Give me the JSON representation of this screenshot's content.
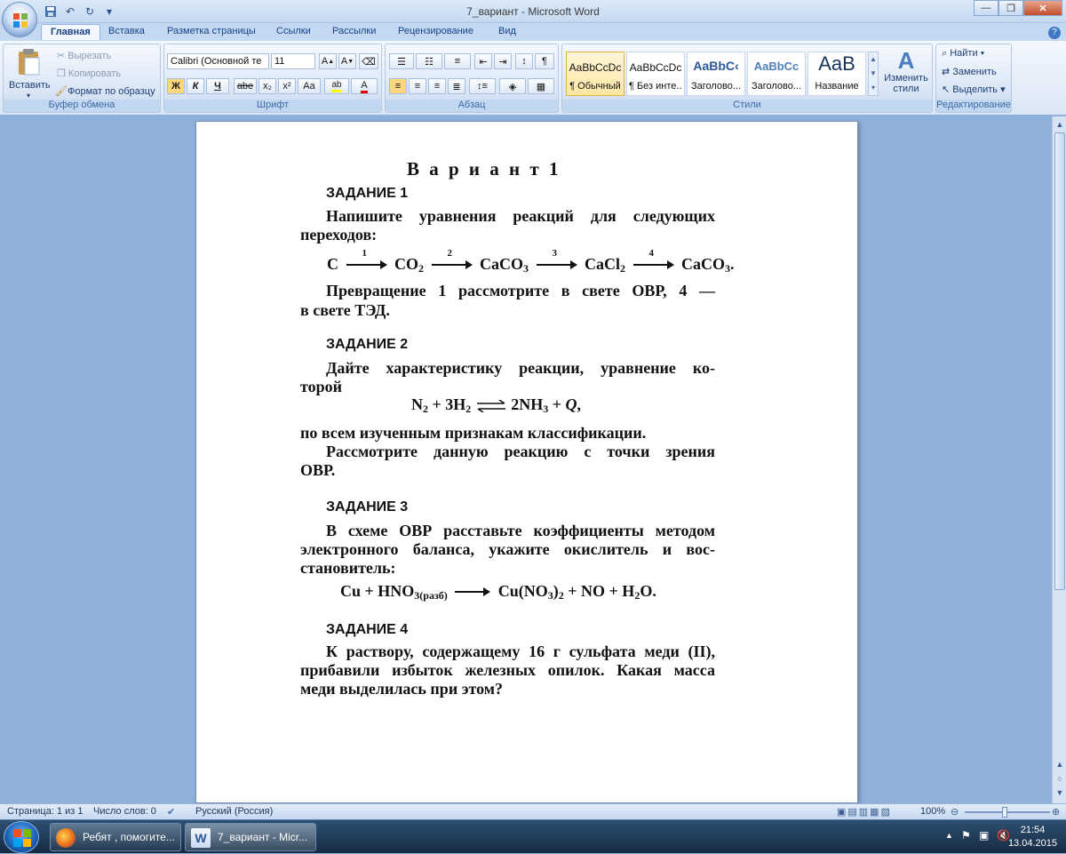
{
  "window": {
    "title": "7_вариант - Microsoft Word",
    "qat": [
      "save-icon",
      "undo-icon",
      "redo-icon",
      "customize-icon"
    ]
  },
  "tabs": [
    "Главная",
    "Вставка",
    "Разметка страницы",
    "Ссылки",
    "Рассылки",
    "Рецензирование",
    "Вид"
  ],
  "ribbon": {
    "clipboard": {
      "label": "Буфер обмена",
      "paste": "Вставить",
      "cut": "Вырезать",
      "copy": "Копировать",
      "format_painter": "Формат по образцу"
    },
    "font": {
      "label": "Шрифт",
      "font_name": "Calibri (Основной те",
      "font_size": "11",
      "bold": "Ж",
      "italic": "К",
      "underline": "Ч",
      "strike": "abe",
      "sub": "x₂",
      "sup": "x²",
      "case": "Aa"
    },
    "paragraph": {
      "label": "Абзац"
    },
    "styles": {
      "label": "Стили",
      "items": [
        {
          "sample": "AaBbCcDc",
          "name": "¶ Обычный"
        },
        {
          "sample": "AaBbCcDc",
          "name": "¶ Без инте..."
        },
        {
          "sample": "AaBbC‹",
          "name": "Заголово..."
        },
        {
          "sample": "AaBbCc",
          "name": "Заголово..."
        },
        {
          "sample": "AaB",
          "name": "Название"
        }
      ],
      "change": "Изменить стили"
    },
    "editing": {
      "label": "Редактирование",
      "find": "Найти",
      "replace": "Заменить",
      "select": "Выделить"
    }
  },
  "document": {
    "title": "В а р и а н т  1",
    "task1": {
      "heading": "ЗАДАНИЕ 1",
      "line1": "Напишите уравнения реакций для следующих",
      "line2": "переходов:",
      "note1": "Превращение 1 рассмотрите в свете ОВР, 4 —",
      "note2": "в свете ТЭД."
    },
    "task2": {
      "heading": "ЗАДАНИЕ 2",
      "line1": "Дайте характеристику реакции, уравнение ко-",
      "line2": "торой",
      "line3": "по всем изученным признакам классификации.",
      "line4": "Рассмотрите данную реакцию с точки зрения",
      "line5": "ОВР."
    },
    "task3": {
      "heading": "ЗАДАНИЕ 3",
      "line1": "В схеме ОВР расставьте коэффициенты методом",
      "line2": "электронного баланса, укажите окислитель и вос-",
      "line3": "становитель:"
    },
    "task4": {
      "heading": "ЗАДАНИЕ 4",
      "line1": "К раствору, содержащему 16 г сульфата меди (II),",
      "line2": "прибавили избыток железных опилок. Какая масса",
      "line3": "меди выделилась при этом?"
    },
    "eq1": {
      "t1": "C",
      "a1": "1",
      "t2": "CO",
      "t2s": "2",
      "a2": "2",
      "t3": "CaCO",
      "t3s": "3",
      "a3": "3",
      "t4": "CaCl",
      "t4s": "2",
      "a4": "4",
      "t5": "CaCO",
      "t5s": "3",
      "t5e": "."
    },
    "eq2": {
      "p1": "N",
      "p1s": "2",
      "p2": " + 3H",
      "p2s": "2",
      "p3": "2NH",
      "p3s": "3",
      "p4": " + ",
      "q": "Q",
      "p5": ","
    },
    "eq3": {
      "p1": "Cu + HNO",
      "p1s": "3(разб)",
      "p2": "Cu(NO",
      "p2s1": "3",
      "p2m": ")",
      "p2s2": "2",
      "p3": " + NO + H",
      "p3s": "2",
      "p4": "O."
    }
  },
  "status": {
    "page": "Страница: 1 из 1",
    "words": "Число слов: 0",
    "lang": "Русский (Россия)",
    "zoom": "100%"
  },
  "taskbar": {
    "items": [
      {
        "label": "Ребят , помогите..."
      },
      {
        "label": "7_вариант - Micr..."
      }
    ],
    "time": "21:54",
    "date": "13.04.2015"
  }
}
